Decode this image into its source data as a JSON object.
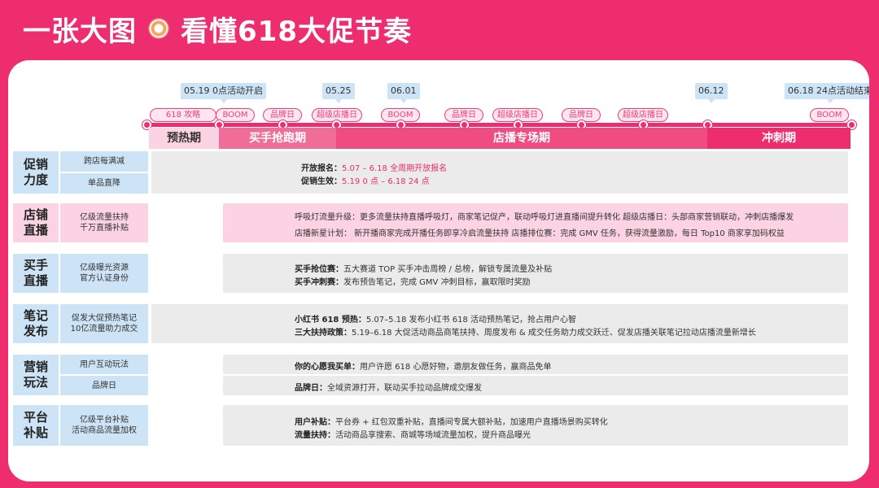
{
  "header": {
    "title_left": "一张大图",
    "title_right": "看懂618大促节奏",
    "ring_icon": "ring-icon"
  },
  "timeline": {
    "dates": [
      "05.19  0点活动开启",
      "05.25",
      "06.01",
      "06.12",
      "06.18  24点活动结束"
    ],
    "tags": [
      "618 攻略",
      "BOOM",
      "品牌日",
      "超级店播日",
      "BOOM",
      "品牌日",
      "超级店播日",
      "品牌日",
      "超级店播日",
      "BOOM"
    ],
    "phases": [
      "预热期",
      "买手抢跑期",
      "店播专场期",
      "冲刺期"
    ]
  },
  "rows": [
    {
      "main": "促销\n力度",
      "subs": [
        "跨店每满减",
        "单品直降"
      ],
      "lines": [
        {
          "label": "开放报名：",
          "text": "5.07 – 6.18 全周期开放报名"
        },
        {
          "label": "促销生效：",
          "text": "5.19 0 点 – 6.18 24 点"
        }
      ]
    },
    {
      "main": "店铺\n直播",
      "subs": [
        "亿级流量扶持\n千万直播补贴"
      ],
      "lines": [
        {
          "text": "呼吸灯流量升级：更多流量扶持直播呼吸灯，商家笔记促产，联动呼吸灯进直播间提升转化    超级店播日：头部商家营销联动，冲刺店播爆发"
        },
        {
          "text": "店播新星计划：  新开播商家完成开播任务即享冷启流量扶持      店播排位赛：完成 GMV 任务，获得流量激励，每日 Top10 商家享加码权益"
        }
      ]
    },
    {
      "main": "买手\n直播",
      "subs": [
        "亿级曝光资源\n官方认证身份"
      ],
      "lines": [
        {
          "label": "买手抢位赛：",
          "text": "五大赛道 TOP 买手冲击周榜 / 总榜，解锁专属流量及补贴"
        },
        {
          "label": "买手冲刺赛：",
          "text": "发布预告笔记，完成 GMV 冲刺目标，赢取限时奖励"
        }
      ]
    },
    {
      "main": "笔记\n发布",
      "subs": [
        "促发大促预热笔记\n10亿流量助力成交"
      ],
      "lines": [
        {
          "label": "小红书 618 预热：",
          "text": "5.07–5.18 发布小红书 618 活动预热笔记，抢占用户心智"
        },
        {
          "label": "三大扶持政策：",
          "text": "5.19–6.18 大促活动商品商笔扶持、周度发布 & 成交任务助力成交跃迁、促发店播关联笔记拉动店播流量新增长"
        }
      ]
    },
    {
      "main": "营销\n玩法",
      "subs": [
        "用户互动玩法",
        "品牌日"
      ],
      "lines": [
        {
          "label": "你的心愿我买单：",
          "text": "用户许愿 618 心愿好物，邀朋友做任务，赢商品免单"
        },
        {
          "label": "品牌日：",
          "text": "全域资源打开，联动买手拉动品牌成交爆发"
        }
      ]
    },
    {
      "main": "平台\n补贴",
      "subs": [
        "亿级平台补贴\n活动商品流量加权"
      ],
      "lines": [
        {
          "label": "用户补贴：",
          "text": "平台券 + 红包双重补贴，直播间专属大额补贴，加速用户直播场景购买转化"
        },
        {
          "label": "流量扶持：",
          "text": "活动商品享搜索、商城等场域流量加权，提升商品曝光"
        }
      ]
    }
  ],
  "colors": {
    "brand": "#ee2d6e",
    "blue": "#cde4f6",
    "pink_light": "#fbd3e2",
    "gray": "#ebebeb",
    "highlight": "#ef2a6c"
  }
}
